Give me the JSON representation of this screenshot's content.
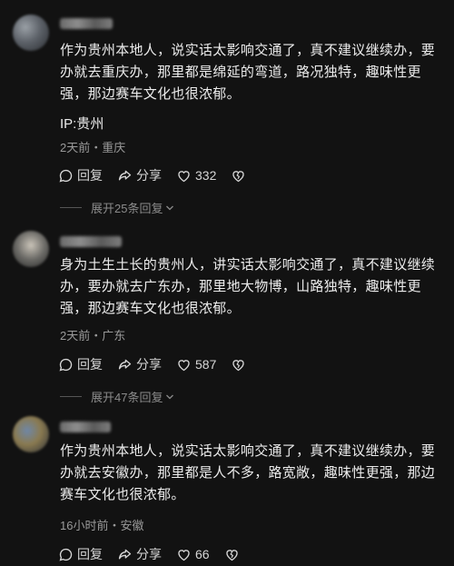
{
  "comments": [
    {
      "text": "作为贵州本地人，说实话太影响交通了，真不建议继续办，要办就去重庆办，那里都是绵延的弯道，路况独特，趣味性更强，那边赛车文化也很浓郁。",
      "ip": "IP:贵州",
      "meta": "2天前・重庆",
      "reply_label": "回复",
      "share_label": "分享",
      "likes": "332",
      "expand_label": "展开25条回复"
    },
    {
      "text": "身为土生土长的贵州人，讲实话太影响交通了，真不建议继续办，要办就去广东办，那里地大物博，山路独特，趣味性更强，那边赛车文化也很浓郁。",
      "meta": "2天前・广东",
      "reply_label": "回复",
      "share_label": "分享",
      "likes": "587",
      "expand_label": "展开47条回复"
    },
    {
      "text": "作为贵州本地人，说实话太影响交通了，真不建议继续办，要办就去安徽办，那里都是人不多，路宽敞，趣味性更强，那边赛车文化也很浓郁。",
      "meta": "16小时前・安徽",
      "reply_label": "回复",
      "share_label": "分享",
      "likes": "66"
    }
  ],
  "icons": {
    "reply": "chat-bubble-icon",
    "share": "share-arrow-icon",
    "like": "heart-icon",
    "dislike": "broken-heart-icon",
    "expand": "chevron-down-icon"
  },
  "colors": {
    "background": "#121212",
    "text": "#ececec",
    "muted": "#9a9a9a"
  }
}
